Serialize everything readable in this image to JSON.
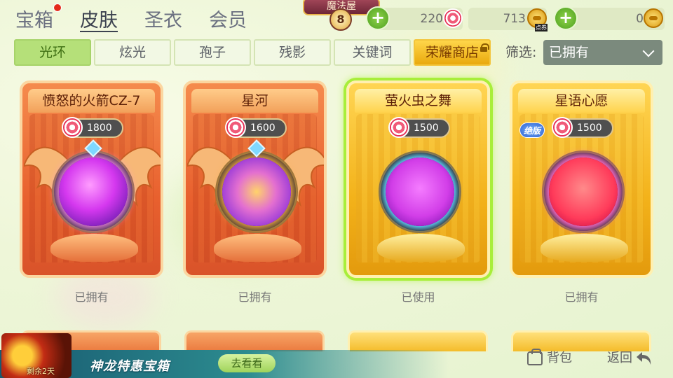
{
  "top_tabs": [
    {
      "label": "宝箱",
      "has_dot": true
    },
    {
      "label": "皮肤",
      "active": true
    },
    {
      "label": "圣衣"
    },
    {
      "label": "会员"
    }
  ],
  "magic_house": {
    "label": "魔法屋",
    "level": "8"
  },
  "currencies": {
    "candy": "220",
    "coupon": "713",
    "coupon_tag": "点券",
    "gold": "0"
  },
  "sub_tabs": [
    {
      "label": "光环",
      "active": true
    },
    {
      "label": "炫光"
    },
    {
      "label": "孢子"
    },
    {
      "label": "残影"
    },
    {
      "label": "关键词"
    },
    {
      "label": "荣耀商店",
      "locked": true
    }
  ],
  "filter": {
    "label": "筛选:",
    "value": "已拥有"
  },
  "cards": [
    {
      "title": "愤怒的火箭CZ-7",
      "price": "1800",
      "status": "已拥有",
      "style": "orange",
      "orb": "purple"
    },
    {
      "title": "星河",
      "price": "1600",
      "status": "已拥有",
      "style": "orange",
      "orb": "nebula"
    },
    {
      "title": "萤火虫之舞",
      "price": "1500",
      "status": "已使用",
      "style": "gold",
      "orb": "magenta",
      "selected": true
    },
    {
      "title": "星语心愿",
      "price": "1500",
      "status": "已拥有",
      "style": "gold",
      "orb": "red",
      "badge": "绝版"
    }
  ],
  "promo": {
    "title": "神龙特惠宝箱",
    "button": "去看看",
    "timer": "剩余2天"
  },
  "bottom": {
    "bag": "背包",
    "back": "返回"
  },
  "colors": {
    "accent_green": "#a8ee3a",
    "orange_card": "#e8602e",
    "gold_card": "#f3b21a"
  }
}
